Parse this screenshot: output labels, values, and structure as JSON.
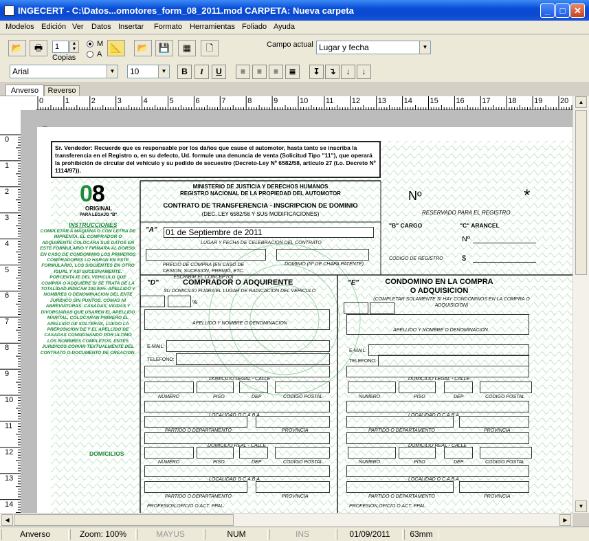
{
  "window": {
    "title": "INGECERT - C:\\Datos...omotores_form_08_2011.mod   CARPETA: Nueva carpeta"
  },
  "menu": [
    "Modelos",
    "Edición",
    "Ver",
    "Datos",
    "Insertar",
    "Formato",
    "Herramientas",
    "Foliado",
    "Ayuda"
  ],
  "toolbar": {
    "copies_value": "1",
    "copies_label": "Copias",
    "radio_m": "M",
    "radio_a": "A",
    "campo_label": "Campo actual",
    "campo_value": "Lugar y fecha"
  },
  "format": {
    "font": "Arial",
    "size": "10",
    "bold": "B",
    "italic": "I",
    "underline": "U"
  },
  "tabs": [
    "Anverso",
    "Reverso"
  ],
  "ruler_h": [
    "0",
    "1",
    "2",
    "3",
    "4",
    "5",
    "6",
    "7",
    "8",
    "9",
    "10",
    "11",
    "12",
    "13",
    "14",
    "15",
    "16",
    "17",
    "18",
    "19",
    "20"
  ],
  "ruler_v": [
    "0",
    "1",
    "2",
    "3",
    "4",
    "5",
    "6",
    "7",
    "8",
    "9",
    "10",
    "11",
    "12",
    "13",
    "14"
  ],
  "form": {
    "notice": "Sr. Vendedor: Recuerde que es responsable por los daños que cause el automotor, hasta tanto se inscriba la transferencia en el Registro o, en su defecto, Ud. formule una denuncia de venta (Solicitud Tipo \"11\"), que operará la prohibición de circular del vehículo y su pedido de secuestro (Decreto-Ley Nº 6582/58, artículo 27 (t.o. Decreto Nº 1114/97)).",
    "code": "08",
    "original": "ORIGINAL",
    "legajo": "PARA LEGAJO \"B\"",
    "ministry1": "MINISTERIO DE JUSTICIA Y DERECHOS HUMANOS",
    "ministry2": "REGISTRO NACIONAL DE LA PROPIEDAD DEL AUTOMOTOR",
    "contract": "CONTRATO DE TRANSFERENCIA - INSCRIPCION DE DOMINIO",
    "law": "(DEC. LEY 6582/58 Y SUS MODIFICACIONES)",
    "num_label": "Nº",
    "reserved": "RESERVADO PARA EL REGISTRO",
    "b_cargo": "\"B\" CARGO",
    "c_arancel": "\"C\" ARANCEL",
    "codigo_registro": "CODIGO DE REGISTRO",
    "num2": "Nº",
    "dollar": "$",
    "instrucciones": "INSTRUCCIONES",
    "side_text": "COMPLETAR A MAQUINA O CON LETRA DE IMPRENTA. EL COMPRADOR O ADQUIRENTE COLOCARA SUS DATOS EN ESTE FORMULARIO Y FIRMARA AL DORSO. EN CASO DE CONDOMINIO LOS PRIMEROS COMPRADORES LO HARAN EN ESTE FORMULARIO, LOS SIGUIENTES EN OTRO IGUAL Y ASI SUCESIVAMENTE. PORCENTAJE DEL VEHICULO QUE COMPRA O ADQUIERE SI SE TRATA DE LA TOTALIDAD INDICAR 100,00%. APELLIDO Y NOMBRES O DENOMINACION DEL ENTE JURIDICO SIN PUNTOS, COMAS NI ABREVIATURAS. CASADAS, VIUDAS Y DIVORCIADAS QUE USAREN EL APELLIDO MARITAL, COLOCARAN PRIMERO EL APELLIDO DE SOLTERAS, LUEGO LA PREPOSICION DE Y EL APELLIDO DE CASADAS CONSIGNANDO POR ULTIMO LOS NOMBRES COMPLETOS. ENTES JURIDICOS COPIAR TEXTUALMENTE DEL CONTRATO O DOCUMENTO DE CREACION.",
    "domicilios": "DOMICILIOS",
    "a_label": "\"A\"",
    "date_value": "01 de Septiembre de 2011",
    "date_caption": "LUGAR Y FECHA DE CELEBRACION DEL CONTRATO",
    "precio": "PRECIO DE COMPRA (EN CASO DE CESION, SUCESION, PREMIO, ETC. ESCRIBIR EL CONCEPTO)",
    "dominio": "DOMINIO (Nº DE CHAPA PATENTE)",
    "d_label": "\"D\"",
    "d_title": "COMPRADOR O ADQUIRENTE",
    "d_sub": "SU DOMICILIO FIJARA EL LUGAR DE RADICACION DEL VEHICULO",
    "e_label": "\"E\"",
    "e_title1": "CONDOMINO EN LA COMPRA",
    "e_title2": "O ADQUISICION",
    "e_sub": "(COMPLETAR SOLAMENTE SI HAY CONDOMINOS EN LA COMPRA O ADQUISICION)",
    "percent": "%",
    "apellido": "APELLIDO Y NOMBRE O DENOMINACION",
    "email": "E-MAIL:",
    "telefono": "TELEFONO:",
    "dom_legal": "DOMICILIO LEGAL - CALLE",
    "numero": "NUMERO",
    "piso": "PISO",
    "dep": "DEP",
    "cp": "CODIGO POSTAL",
    "localidad": "LOCALIDAD O C.A.B.A.",
    "partido": "PARTIDO O DEPARTAMENTO",
    "provincia": "PROVINCIA",
    "dom_real": "DOMICILIO REAL - CALLE",
    "profesion": "PROFESION,OFICIO O ACT. PPAL."
  },
  "status": {
    "side": "Anverso",
    "zoom": "Zoom:  100%",
    "mayus": "MAYUS",
    "num": "NUM",
    "ins": "INS",
    "date": "01/09/2011",
    "pos": "63mm"
  }
}
